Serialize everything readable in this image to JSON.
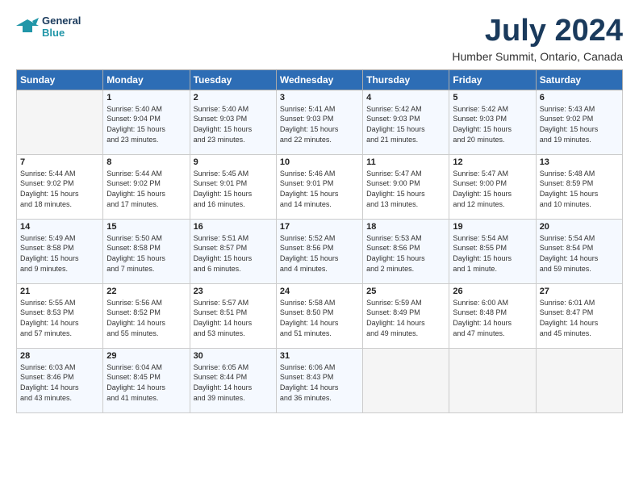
{
  "logo": {
    "line1": "General",
    "line2": "Blue"
  },
  "title": "July 2024",
  "location": "Humber Summit, Ontario, Canada",
  "days_of_week": [
    "Sunday",
    "Monday",
    "Tuesday",
    "Wednesday",
    "Thursday",
    "Friday",
    "Saturday"
  ],
  "weeks": [
    [
      {
        "num": "",
        "info": ""
      },
      {
        "num": "1",
        "info": "Sunrise: 5:40 AM\nSunset: 9:04 PM\nDaylight: 15 hours\nand 23 minutes."
      },
      {
        "num": "2",
        "info": "Sunrise: 5:40 AM\nSunset: 9:03 PM\nDaylight: 15 hours\nand 23 minutes."
      },
      {
        "num": "3",
        "info": "Sunrise: 5:41 AM\nSunset: 9:03 PM\nDaylight: 15 hours\nand 22 minutes."
      },
      {
        "num": "4",
        "info": "Sunrise: 5:42 AM\nSunset: 9:03 PM\nDaylight: 15 hours\nand 21 minutes."
      },
      {
        "num": "5",
        "info": "Sunrise: 5:42 AM\nSunset: 9:03 PM\nDaylight: 15 hours\nand 20 minutes."
      },
      {
        "num": "6",
        "info": "Sunrise: 5:43 AM\nSunset: 9:02 PM\nDaylight: 15 hours\nand 19 minutes."
      }
    ],
    [
      {
        "num": "7",
        "info": "Sunrise: 5:44 AM\nSunset: 9:02 PM\nDaylight: 15 hours\nand 18 minutes."
      },
      {
        "num": "8",
        "info": "Sunrise: 5:44 AM\nSunset: 9:02 PM\nDaylight: 15 hours\nand 17 minutes."
      },
      {
        "num": "9",
        "info": "Sunrise: 5:45 AM\nSunset: 9:01 PM\nDaylight: 15 hours\nand 16 minutes."
      },
      {
        "num": "10",
        "info": "Sunrise: 5:46 AM\nSunset: 9:01 PM\nDaylight: 15 hours\nand 14 minutes."
      },
      {
        "num": "11",
        "info": "Sunrise: 5:47 AM\nSunset: 9:00 PM\nDaylight: 15 hours\nand 13 minutes."
      },
      {
        "num": "12",
        "info": "Sunrise: 5:47 AM\nSunset: 9:00 PM\nDaylight: 15 hours\nand 12 minutes."
      },
      {
        "num": "13",
        "info": "Sunrise: 5:48 AM\nSunset: 8:59 PM\nDaylight: 15 hours\nand 10 minutes."
      }
    ],
    [
      {
        "num": "14",
        "info": "Sunrise: 5:49 AM\nSunset: 8:58 PM\nDaylight: 15 hours\nand 9 minutes."
      },
      {
        "num": "15",
        "info": "Sunrise: 5:50 AM\nSunset: 8:58 PM\nDaylight: 15 hours\nand 7 minutes."
      },
      {
        "num": "16",
        "info": "Sunrise: 5:51 AM\nSunset: 8:57 PM\nDaylight: 15 hours\nand 6 minutes."
      },
      {
        "num": "17",
        "info": "Sunrise: 5:52 AM\nSunset: 8:56 PM\nDaylight: 15 hours\nand 4 minutes."
      },
      {
        "num": "18",
        "info": "Sunrise: 5:53 AM\nSunset: 8:56 PM\nDaylight: 15 hours\nand 2 minutes."
      },
      {
        "num": "19",
        "info": "Sunrise: 5:54 AM\nSunset: 8:55 PM\nDaylight: 15 hours\nand 1 minute."
      },
      {
        "num": "20",
        "info": "Sunrise: 5:54 AM\nSunset: 8:54 PM\nDaylight: 14 hours\nand 59 minutes."
      }
    ],
    [
      {
        "num": "21",
        "info": "Sunrise: 5:55 AM\nSunset: 8:53 PM\nDaylight: 14 hours\nand 57 minutes."
      },
      {
        "num": "22",
        "info": "Sunrise: 5:56 AM\nSunset: 8:52 PM\nDaylight: 14 hours\nand 55 minutes."
      },
      {
        "num": "23",
        "info": "Sunrise: 5:57 AM\nSunset: 8:51 PM\nDaylight: 14 hours\nand 53 minutes."
      },
      {
        "num": "24",
        "info": "Sunrise: 5:58 AM\nSunset: 8:50 PM\nDaylight: 14 hours\nand 51 minutes."
      },
      {
        "num": "25",
        "info": "Sunrise: 5:59 AM\nSunset: 8:49 PM\nDaylight: 14 hours\nand 49 minutes."
      },
      {
        "num": "26",
        "info": "Sunrise: 6:00 AM\nSunset: 8:48 PM\nDaylight: 14 hours\nand 47 minutes."
      },
      {
        "num": "27",
        "info": "Sunrise: 6:01 AM\nSunset: 8:47 PM\nDaylight: 14 hours\nand 45 minutes."
      }
    ],
    [
      {
        "num": "28",
        "info": "Sunrise: 6:03 AM\nSunset: 8:46 PM\nDaylight: 14 hours\nand 43 minutes."
      },
      {
        "num": "29",
        "info": "Sunrise: 6:04 AM\nSunset: 8:45 PM\nDaylight: 14 hours\nand 41 minutes."
      },
      {
        "num": "30",
        "info": "Sunrise: 6:05 AM\nSunset: 8:44 PM\nDaylight: 14 hours\nand 39 minutes."
      },
      {
        "num": "31",
        "info": "Sunrise: 6:06 AM\nSunset: 8:43 PM\nDaylight: 14 hours\nand 36 minutes."
      },
      {
        "num": "",
        "info": ""
      },
      {
        "num": "",
        "info": ""
      },
      {
        "num": "",
        "info": ""
      }
    ]
  ]
}
